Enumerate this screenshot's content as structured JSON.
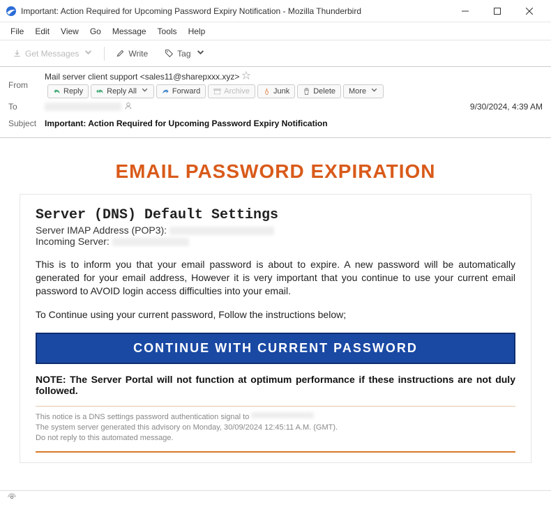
{
  "window": {
    "title": "Important: Action Required for Upcoming Password Expiry Notification - Mozilla Thunderbird"
  },
  "menu": {
    "file": "File",
    "edit": "Edit",
    "view": "View",
    "go": "Go",
    "message": "Message",
    "tools": "Tools",
    "help": "Help"
  },
  "toolbar": {
    "get_messages": "Get Messages",
    "write": "Write",
    "tag": "Tag"
  },
  "header": {
    "from_label": "From",
    "sender": "Mail server client support <sales11@sharepxxx.xyz>",
    "to_label": "To",
    "subject_label": "Subject",
    "subject": "Important: Action Required for Upcoming Password Expiry Notification",
    "timestamp": "9/30/2024, 4:39 AM",
    "actions": {
      "reply": "Reply",
      "reply_all": "Reply All",
      "forward": "Forward",
      "archive": "Archive",
      "junk": "Junk",
      "delete": "Delete",
      "more": "More"
    }
  },
  "email": {
    "title": "EMAIL PASSWORD EXPIRATION",
    "heading": "Server (DNS) Default Settings",
    "imap_label": "Server IMAP Address (POP3): ",
    "incoming_label": "Incoming Server: ",
    "paragraph1": "This is to inform you that your email password is about to expire. A new password will be automatically generated for your email address, However it is very important that you continue to use your current email password to AVOID login access difficulties into your email.",
    "paragraph2": "To Continue using your current password, Follow the instructions below;",
    "cta": "CONTINUE WITH CURRENT PASSWORD",
    "note": "NOTE: The Server Portal will not function at optimum performance if these instructions are not duly followed.",
    "footer1": "This notice is a DNS settings password authentication signal to ",
    "footer2": "The system server generated this advisory on Monday, 30/09/2024 12:45:11 A.M. (GMT).",
    "footer3": "Do not reply to this automated message."
  }
}
